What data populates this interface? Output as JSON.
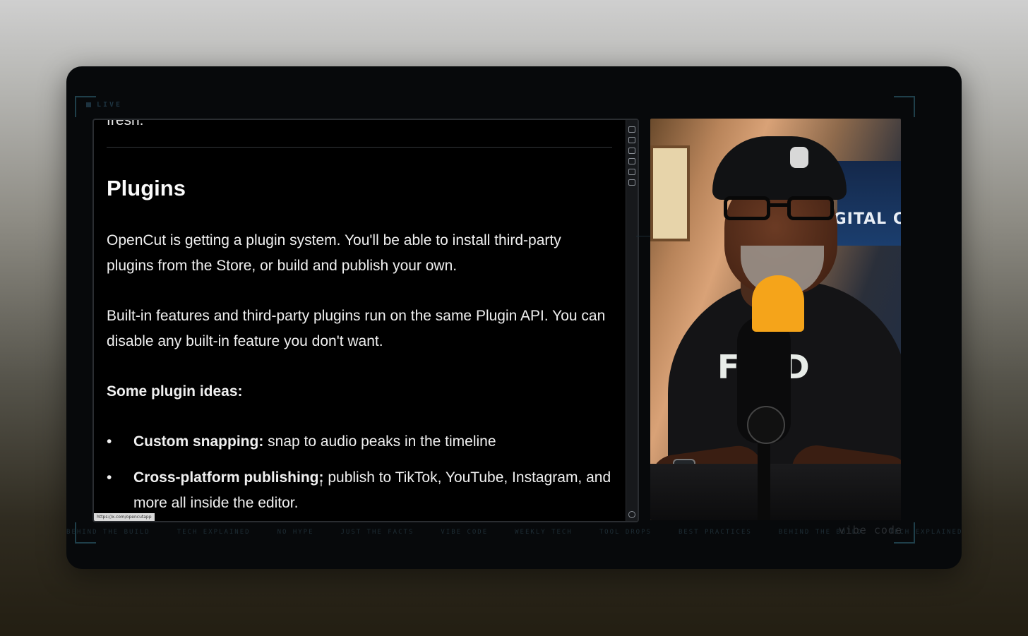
{
  "overlay": {
    "live_label": "LIVE",
    "ticker": [
      "BEHIND THE BUILD",
      "TECH EXPLAINED",
      "NO HYPE",
      "JUST THE FACTS",
      "VIBE CODE",
      "WEEKLY TECH",
      "TOOL DROPS",
      "BEST PRACTICES",
      "BEHIND THE BUILD",
      "TECH EXPLAINED"
    ],
    "watermark": "vibe code"
  },
  "document": {
    "top_fragment": "fresh.",
    "heading": "Plugins",
    "paragraph1": "OpenCut is getting a plugin system. You'll be able to install third-party plugins from the Store, or build and publish your own.",
    "paragraph2": "Built-in features and third-party plugins run on the same Plugin API. You can disable any built-in feature you don't want.",
    "ideas_heading": "Some plugin ideas:",
    "bullets": [
      {
        "bold": "Custom snapping:",
        "text": " snap to audio peaks in the timeline"
      },
      {
        "bold": "Cross-platform publishing:",
        "text": " publish to TikTok, YouTube, Instagram, and more all inside the editor."
      }
    ],
    "status_url": "https://x.com/opencutapp"
  },
  "webcam": {
    "sign_text": "GITAL C",
    "shirt_text": "FO  D"
  },
  "colors": {
    "frame_bg": "#07090b",
    "doc_bg": "#000000",
    "mic_accent": "#f5a41a"
  }
}
